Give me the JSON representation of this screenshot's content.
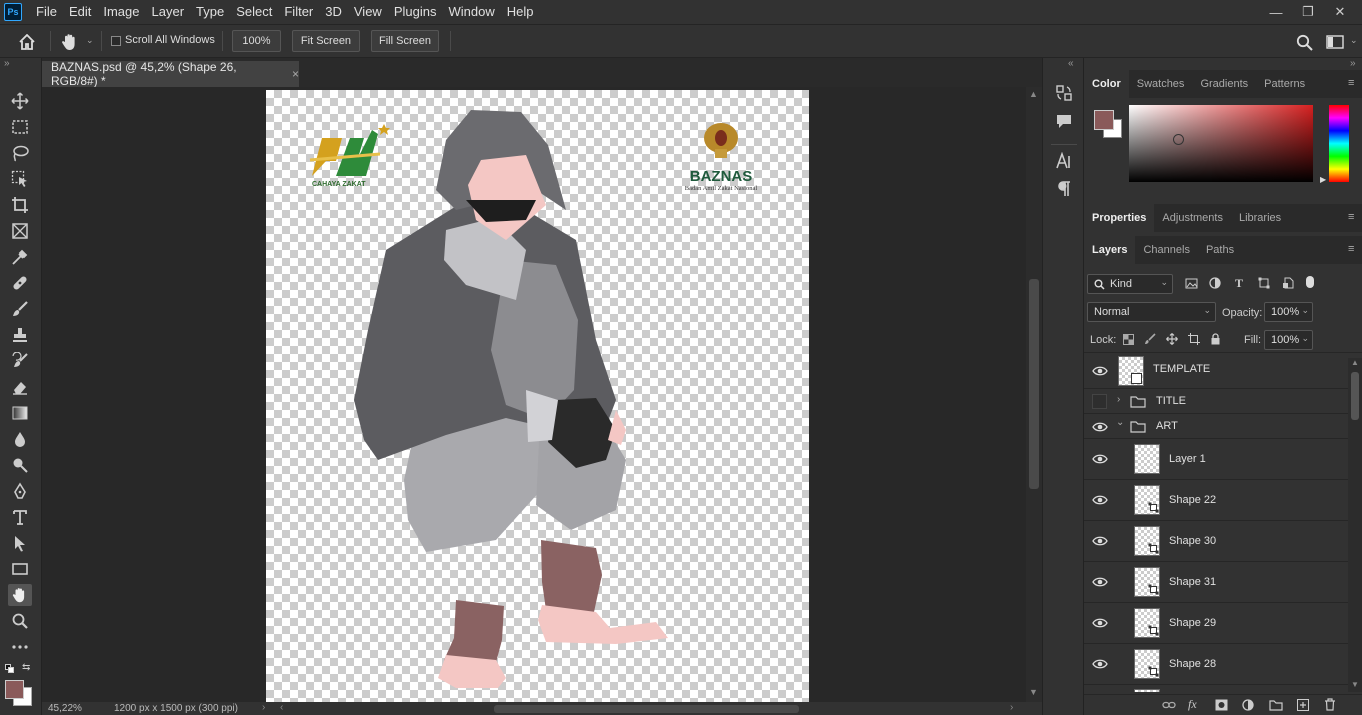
{
  "app": {
    "logo": "Ps"
  },
  "menu": [
    "File",
    "Edit",
    "Image",
    "Layer",
    "Type",
    "Select",
    "Filter",
    "3D",
    "View",
    "Plugins",
    "Window",
    "Help"
  ],
  "window_controls": {
    "minimize": "—",
    "restore": "❐",
    "close": "✕"
  },
  "options": {
    "scroll_all_windows": "Scroll All Windows",
    "zoom_value": "100%",
    "fit_screen": "Fit Screen",
    "fill_screen": "Fill Screen"
  },
  "document": {
    "tab_title": "BAZNAS.psd @ 45,2% (Shape 26, RGB/8#) *",
    "close": "×",
    "logo_left_text": "CAHAYA ZAKAT",
    "logo_right_title": "BAZNAS",
    "logo_right_subtitle": "Badan Amil Zakat Nasional"
  },
  "status": {
    "zoom": "45,22%",
    "doc_info": "1200 px x 1500 px (300 ppi)"
  },
  "colors": {
    "foreground": "#8a5a5a",
    "background": "#ffffff",
    "accent": "#31a8ff"
  },
  "color_panel": {
    "tabs": [
      "Color",
      "Swatches",
      "Gradients",
      "Patterns"
    ],
    "active": "Color",
    "hue_color": "#d62020"
  },
  "properties_panel": {
    "tabs": [
      "Properties",
      "Adjustments",
      "Libraries"
    ],
    "active": "Properties"
  },
  "layers_panel": {
    "tabs": [
      "Layers",
      "Channels",
      "Paths"
    ],
    "active": "Layers",
    "filter_label": "Kind",
    "blend_mode": "Normal",
    "opacity_label": "Opacity:",
    "opacity_value": "100%",
    "lock_label": "Lock:",
    "fill_label": "Fill:",
    "fill_value": "100%",
    "layers": [
      {
        "name": "TEMPLATE",
        "kind": "smart",
        "visible": true
      },
      {
        "name": "TITLE",
        "kind": "group",
        "visible": false,
        "expanded": false
      },
      {
        "name": "ART",
        "kind": "group",
        "visible": true,
        "expanded": true
      },
      {
        "name": "Layer 1",
        "kind": "pixel",
        "visible": true
      },
      {
        "name": "Shape 22",
        "kind": "shape",
        "visible": true
      },
      {
        "name": "Shape 30",
        "kind": "shape",
        "visible": true
      },
      {
        "name": "Shape 31",
        "kind": "shape",
        "visible": true
      },
      {
        "name": "Shape 29",
        "kind": "shape",
        "visible": true
      },
      {
        "name": "Shape 28",
        "kind": "shape",
        "visible": true
      }
    ]
  }
}
